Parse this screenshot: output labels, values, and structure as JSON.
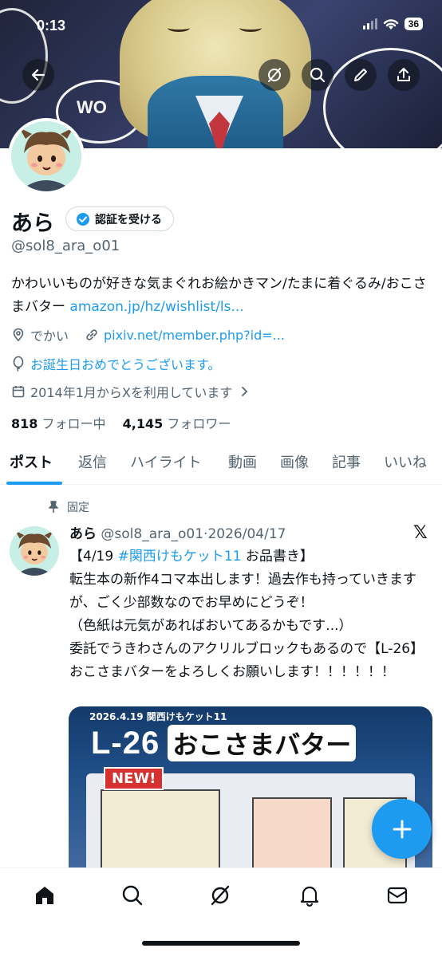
{
  "status_bar": {
    "time": "0:13",
    "battery": "36"
  },
  "header_actions": [
    "back-arrow-icon",
    "grok-icon",
    "search-icon",
    "edit-icon",
    "share-icon"
  ],
  "profile": {
    "name": "あら",
    "verify_button": "認証を受ける",
    "handle": "@sol8_ara_o01",
    "bio_text": "かわいいものが好きな気まぐれお絵かきマン/たまに着ぐるみ/おこさまバター ",
    "bio_link": "amazon.jp/hz/wishlist/ls...",
    "location": "でかい",
    "website": "pixiv.net/member.php?id=...",
    "birthday": "お誕生日おめでとうございます。",
    "joined": "2014年1月からXを利用しています",
    "following_count": "818",
    "following_label": "フォロー中",
    "followers_count": "4,145",
    "followers_label": "フォロワー"
  },
  "tabs": [
    "ポスト",
    "返信",
    "ハイライト",
    "動画",
    "画像",
    "記事",
    "いいね"
  ],
  "post": {
    "pinned_label": "固定",
    "author": "あら",
    "handle_date": "@sol8_ara_o01·2026/04/17",
    "line1_prefix": "【4/19 ",
    "line1_tag": "#関西けもケット11",
    "line1_suffix": " お品書き】",
    "body": "転生本の新作4コマ本出します！過去作も持っていきますが、ごく少部数なのでお早めにどうぞ！\n（色紙は元気があればおいてあるかもです...）\n委託でうきわさんのアクリルブロックもあるので【L-26】おこさまバターをよろしくお願いします！！！！！！",
    "media": {
      "date_text": "2026.4.19 関西けもケット11",
      "booth": "L-26",
      "circle": "おこさまバター",
      "new_badge": "NEW!"
    }
  },
  "colors": {
    "accent": "#1d9bf0",
    "text": "#0f1419",
    "secondary": "#536471"
  }
}
